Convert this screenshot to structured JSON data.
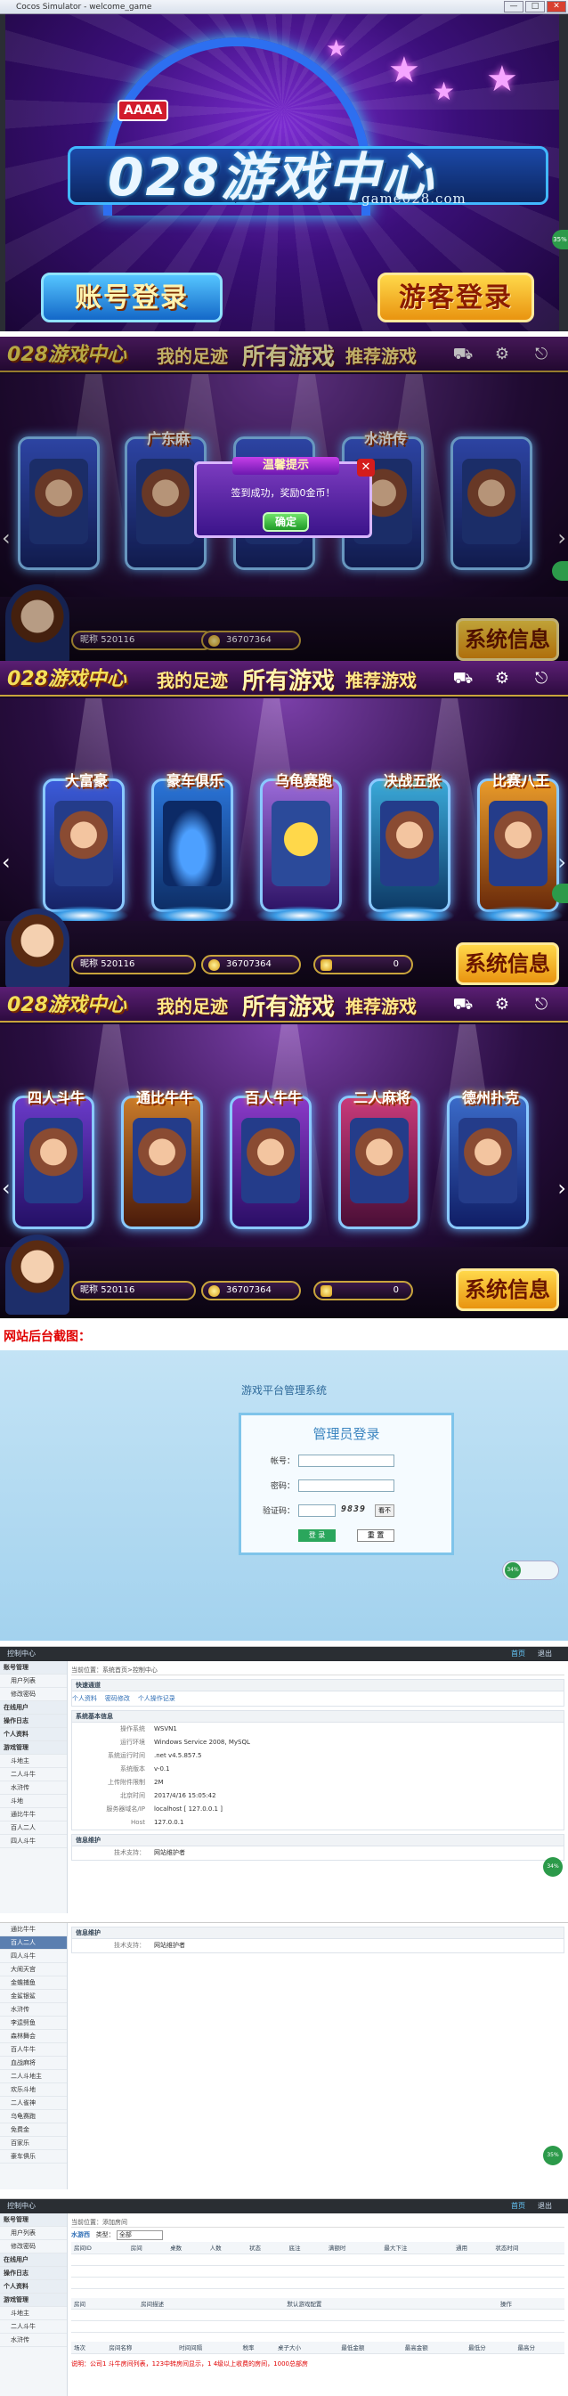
{
  "window": {
    "title": "Cocos Simulator - welcome_game",
    "ctl_min": "—",
    "ctl_max": "□",
    "ctl_close": "✕"
  },
  "splash": {
    "logo_main": "028游戏中心",
    "logo_url": "game028.com",
    "cards_badge": "AAAA",
    "btn_account": "账号登录",
    "btn_guest": "游客登录",
    "side_pct": "35%"
  },
  "lobby": {
    "brand": "028游戏中心",
    "tabs": [
      "我的足迹",
      "所有游戏",
      "推荐游戏"
    ],
    "icons": [
      "cart-icon",
      "gear-icon",
      "exit-icon"
    ],
    "nickname_label": "昵称",
    "nickname_value": "520116",
    "coins": "36707364",
    "ingots": "0",
    "system_btn": "系统信息",
    "row1_games": [
      "",
      "广东麻",
      "",
      "水浒传",
      ""
    ],
    "row2_games": [
      "大富豪",
      "豪车俱乐",
      "乌龟赛跑",
      "决战五张",
      "比赛八王"
    ],
    "row3_games": [
      "四人斗牛",
      "通比牛牛",
      "百人牛牛",
      "二人麻将",
      "德州扑克"
    ],
    "modal_title": "温馨提示",
    "modal_msg": "签到成功，奖励0金币！",
    "modal_ok": "确定"
  },
  "heading": "网站后台截图：",
  "login": {
    "platform_title": "游戏平台管理系统",
    "box_title": "管理员登录",
    "user_label": "帐号：",
    "pass_label": "密码：",
    "code_label": "验证码：",
    "captcha": "9839",
    "captcha_btn": "看不",
    "submit": "登 录",
    "reset": "重 置",
    "pct": "34%"
  },
  "admin": {
    "topbar": "控制中心",
    "top_right_1": "首页",
    "top_right_2": "退出",
    "side1": [
      "账号管理",
      "用户列表",
      "修改密码",
      "在线用户",
      "操作日志",
      "个人资料",
      "游戏管理",
      "斗地主",
      "二人斗牛",
      "水浒传",
      "斗地",
      "通比牛牛",
      "百人二人",
      "四人斗牛"
    ],
    "crumb": "当前位置：系统首页>控制中心",
    "tabs": [
      "个人资料",
      "密码修改",
      "个人操作记录"
    ],
    "panel_basic": "系统基本信息",
    "basic_head": "快速通道",
    "kv": [
      [
        "操作系统",
        "WSVN1"
      ],
      [
        "运行环境",
        "Windows Service 2008, MySQL"
      ],
      [
        "系统运行时间",
        ".net v4.5.857.5"
      ],
      [
        "系统版本",
        "v-0.1"
      ],
      [
        "上传附件限制",
        "2M"
      ],
      [
        "北京时间",
        "2017/4/16 15:05:42"
      ],
      [
        "服务器域名/IP",
        "localhost [ 127.0.0.1 ]"
      ],
      [
        "Host",
        "127.0.0.1"
      ]
    ],
    "panel_contact": "信息维护",
    "support_label": "技术支持：",
    "support_value": "网站维护者",
    "pct": "34%",
    "side2": [
      "通比牛牛",
      "百人二人",
      "四人斗牛",
      "大闹天宫",
      "金蟾捕鱼",
      "金鲨银鲨",
      "水浒传",
      "李逵劈鱼",
      "森林舞会",
      "百人牛牛",
      "血战麻将",
      "二人斗地主",
      "欢乐斗地",
      "二人雀神",
      "乌龟赛跑",
      "免费金",
      "百家乐",
      "豪车俱乐"
    ],
    "pct2": "35%",
    "side3": [
      "账号管理",
      "用户列表",
      "修改密码",
      "在线用户",
      "操作日志",
      "个人资料",
      "游戏管理",
      "斗地主",
      "二人斗牛",
      "水浒传"
    ],
    "crumb3": "当前位置：添加房间",
    "list_title": "水游西",
    "filter_label": "类型：",
    "filter_value": "全部",
    "cols1": [
      "房间ID",
      "房间",
      "桌数",
      "人数",
      "状态",
      "底注",
      "满额时",
      "最大下注",
      "通用",
      "状态时间"
    ],
    "cols2": [
      "房间",
      "房间描述",
      "",
      "",
      "默认游戏配置",
      "",
      "",
      "",
      "操作"
    ],
    "cols3": [
      "场次",
      "房间名称",
      "",
      "时间间隔",
      "税率",
      "桌子大小",
      "最低金额",
      "最高金额",
      "最低分",
      "最高分"
    ],
    "red_note": "说明：公司1 斗牛房间列表，123中转房间显示，1 4级以上收费的房间，1000总部房"
  }
}
